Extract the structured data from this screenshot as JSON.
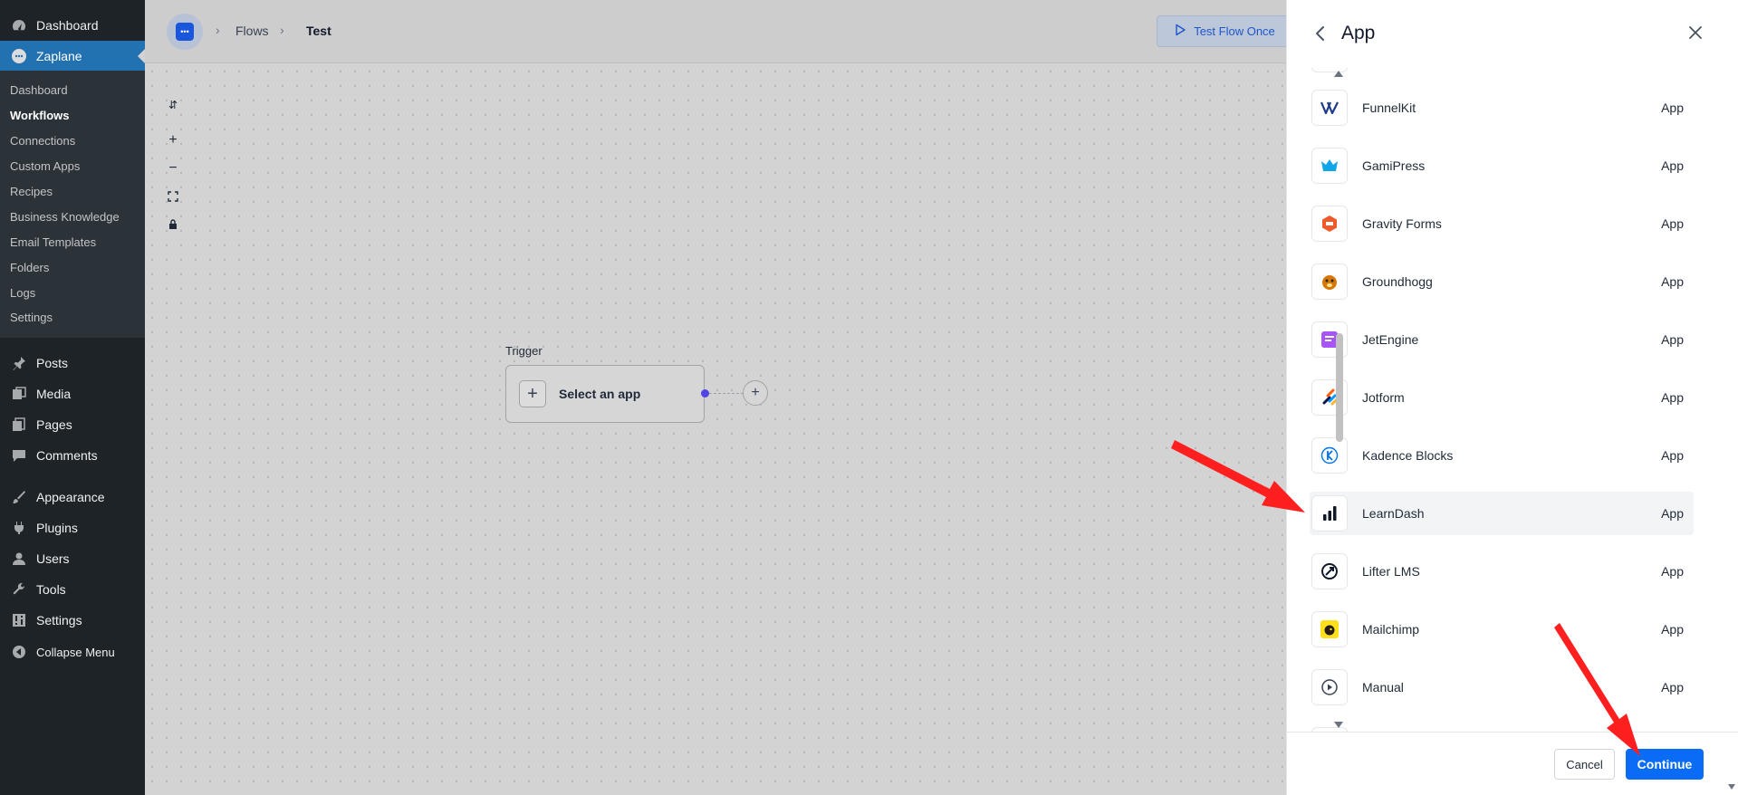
{
  "wp_menu": {
    "dashboard": "Dashboard",
    "zaplane": "Zaplane",
    "submenu": [
      "Dashboard",
      "Workflows",
      "Connections",
      "Custom Apps",
      "Recipes",
      "Business Knowledge",
      "Email Templates",
      "Folders",
      "Logs",
      "Settings"
    ],
    "posts": "Posts",
    "media": "Media",
    "pages": "Pages",
    "comments": "Comments",
    "appearance": "Appearance",
    "plugins": "Plugins",
    "users": "Users",
    "tools": "Tools",
    "settings": "Settings",
    "collapse": "Collapse Menu"
  },
  "topbar": {
    "breadcrumb": [
      "Flows",
      "Test"
    ],
    "test_button": "Test Flow Once"
  },
  "canvas": {
    "trigger_label": "Trigger",
    "trigger_node_text": "Select an app"
  },
  "panel": {
    "title": "App",
    "apps": [
      {
        "name": "FunnelKit",
        "type": "App",
        "icon": "funnelkit-icon"
      },
      {
        "name": "GamiPress",
        "type": "App",
        "icon": "gamipress-icon"
      },
      {
        "name": "Gravity Forms",
        "type": "App",
        "icon": "gravity-forms-icon"
      },
      {
        "name": "Groundhogg",
        "type": "App",
        "icon": "groundhogg-icon"
      },
      {
        "name": "JetEngine",
        "type": "App",
        "icon": "jetengine-icon"
      },
      {
        "name": "Jotform",
        "type": "App",
        "icon": "jotform-icon"
      },
      {
        "name": "Kadence Blocks",
        "type": "App",
        "icon": "kadence-blocks-icon"
      },
      {
        "name": "LearnDash",
        "type": "App",
        "icon": "learndash-icon"
      },
      {
        "name": "Lifter LMS",
        "type": "App",
        "icon": "lifter-lms-icon"
      },
      {
        "name": "Mailchimp",
        "type": "App",
        "icon": "mailchimp-icon"
      },
      {
        "name": "Manual",
        "type": "App",
        "icon": "manual-icon"
      }
    ],
    "cancel": "Cancel",
    "continue": "Continue"
  },
  "colors": {
    "wp_sidebar": "#1d2327",
    "wp_active": "#2271b1",
    "primary": "#0a6cf5",
    "annotation_arrow": "#ff1f1f"
  }
}
